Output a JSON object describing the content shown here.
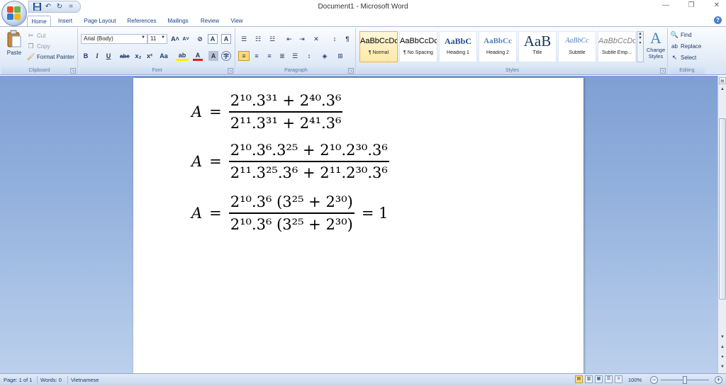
{
  "window": {
    "title": "Document1 - Microsoft Word",
    "minimize": "—",
    "restore": "❐",
    "close": "✕"
  },
  "qat": {
    "save_icon": "save-icon",
    "undo_icon": "undo-icon",
    "redo_icon": "redo-icon",
    "customize": "="
  },
  "tabs": [
    "Home",
    "Insert",
    "Page Layout",
    "References",
    "Mailings",
    "Review",
    "View"
  ],
  "ribbon": {
    "clipboard": {
      "label": "Clipboard",
      "paste": "Paste",
      "cut": "Cut",
      "copy": "Copy",
      "format_painter": "Format Painter"
    },
    "font": {
      "label": "Font",
      "font_name": "Arial (Body)",
      "font_size": "11",
      "grow": "A˄",
      "shrink": "A˅",
      "clear": "⊘",
      "bold": "B",
      "italic": "I",
      "underline": "U",
      "strike": "abe",
      "subscript": "x₂",
      "superscript": "x²",
      "change_case": "Aa",
      "highlight": "ab",
      "font_color": "A"
    },
    "paragraph": {
      "label": "Paragraph"
    },
    "styles": {
      "label": "Styles",
      "items": [
        {
          "sample": "AaBbCcDc",
          "name": "¶ Normal"
        },
        {
          "sample": "AaBbCcDc",
          "name": "¶ No Spacing"
        },
        {
          "sample": "AaBbC",
          "name": "Heading 1"
        },
        {
          "sample": "AaBbCc",
          "name": "Heading 2"
        },
        {
          "sample": "AaB",
          "name": "Title"
        },
        {
          "sample": "AaBbCc",
          "name": "Subtitle"
        },
        {
          "sample": "AaBbCcDc",
          "name": "Subtle Emp..."
        }
      ],
      "change_styles": "Change Styles"
    },
    "editing": {
      "label": "Editing",
      "find": "Find",
      "replace": "Replace",
      "select": "Select"
    }
  },
  "document": {
    "equations": [
      {
        "lhs": "A",
        "numerator": "2¹⁰.3³¹ + 2⁴⁰.3⁶",
        "denominator": "2¹¹.3³¹ + 2⁴¹.3⁶",
        "rhs": ""
      },
      {
        "lhs": "A",
        "numerator": "2¹⁰.3⁶.3²⁵ + 2¹⁰.2³⁰.3⁶",
        "denominator": "2¹¹.3²⁵.3⁶ + 2¹¹.2³⁰.3⁶",
        "rhs": ""
      },
      {
        "lhs": "A",
        "numerator": "2¹⁰.3⁶ (3²⁵ + 2³⁰)",
        "denominator": "2¹⁰.3⁶ (3²⁵ + 2³⁰)",
        "rhs": "= 1"
      }
    ]
  },
  "status": {
    "page": "Page: 1 of 1",
    "words": "Words: 0",
    "language": "Vietnamese",
    "zoom": "100%"
  }
}
